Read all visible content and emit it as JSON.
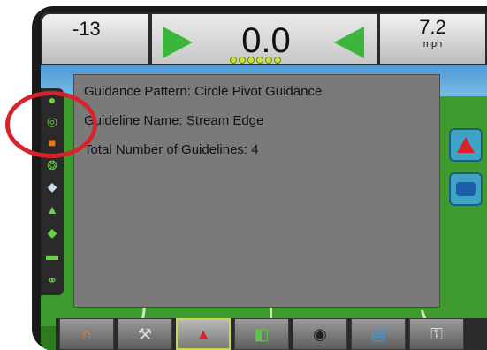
{
  "topbar": {
    "cross_track": "-13",
    "cross_track_error": "0.0",
    "speed_value": "7.2",
    "speed_unit": "mph",
    "lightbar_leds": 6
  },
  "popup": {
    "pattern_line": "Guidance Pattern: Circle Pivot Guidance",
    "guideline_line": "Guideline Name: Stream Edge",
    "total_line": "Total Number of Guidelines: 4"
  },
  "sidebar": {
    "icons": [
      "guidance-off-icon",
      "circle-pivot-icon",
      "lock-icon",
      "steering-icon",
      "boom-icon",
      "marker-icon",
      "drop-icon",
      "vehicle-icon",
      "link-icon"
    ]
  },
  "right_buttons": [
    "guidance-mode-icon",
    "message-icon"
  ],
  "bottom_tabs": [
    {
      "icon": "home-icon",
      "active": false
    },
    {
      "icon": "tools-icon",
      "active": false
    },
    {
      "icon": "guidance-screen-icon",
      "active": true
    },
    {
      "icon": "field-view-icon",
      "active": false
    },
    {
      "icon": "camera-icon",
      "active": false
    },
    {
      "icon": "data-icon",
      "active": false
    },
    {
      "icon": "unlock-info-icon",
      "active": false
    }
  ],
  "colors": {
    "accent_green": "#3bb63b",
    "highlight_ring": "#d9232c",
    "field_green": "#3f9b2e"
  }
}
